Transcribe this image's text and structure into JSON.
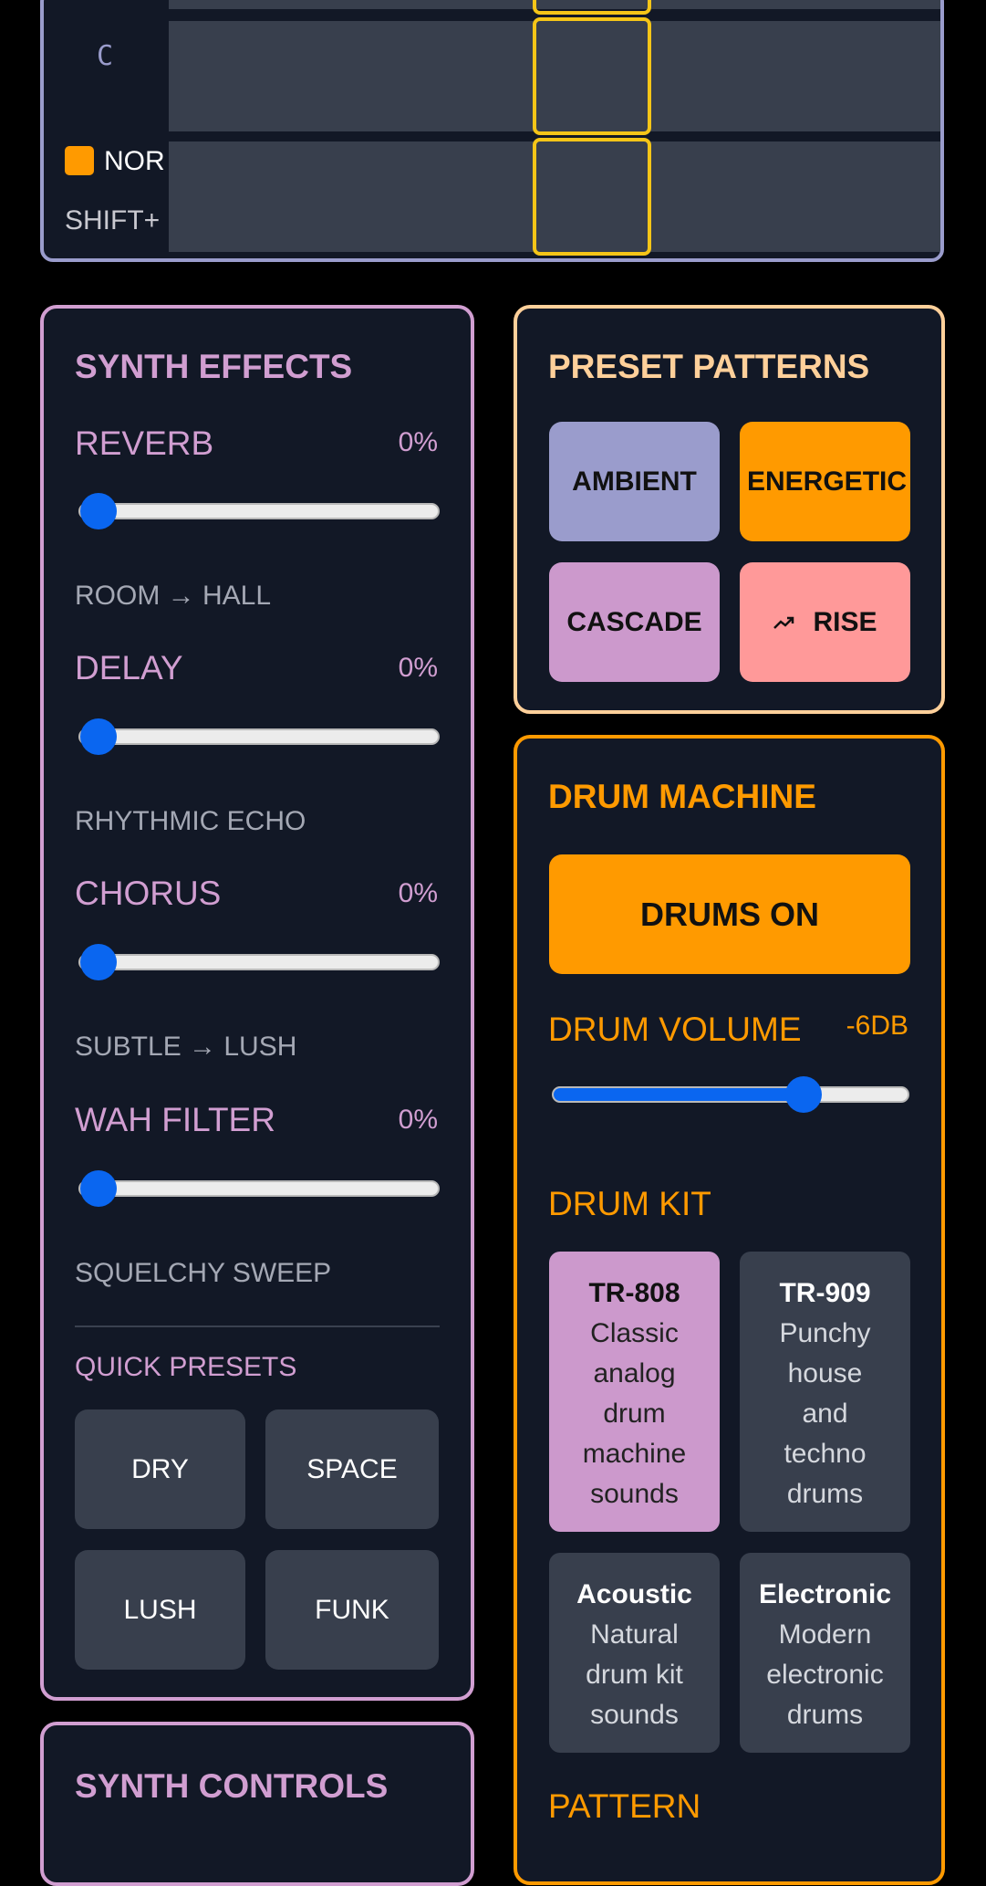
{
  "sequencer": {
    "note_label": "C",
    "mode_label": "NOR",
    "shift_label": "SHIFT+",
    "mode_color": "#ff9a00",
    "highlight_color": "#f5c518"
  },
  "synth_effects": {
    "title": "SYNTH EFFECTS",
    "effects": [
      {
        "label": "REVERB",
        "value": "0%",
        "level": 0,
        "desc": "ROOM → HALL"
      },
      {
        "label": "DELAY",
        "value": "0%",
        "level": 0,
        "desc": "RHYTHMIC ECHO"
      },
      {
        "label": "CHORUS",
        "value": "0%",
        "level": 0,
        "desc": "SUBTLE → LUSH"
      },
      {
        "label": "WAH FILTER",
        "value": "0%",
        "level": 0,
        "desc": "SQUELCHY SWEEP"
      }
    ],
    "quick_presets_title": "QUICK PRESETS",
    "quick_presets": [
      "DRY",
      "SPACE",
      "LUSH",
      "FUNK"
    ]
  },
  "preset_patterns": {
    "title": "PRESET PATTERNS",
    "buttons": [
      {
        "label": "AMBIENT",
        "color": "#9a9ccc"
      },
      {
        "label": "ENERGETIC",
        "color": "#ff9a00"
      },
      {
        "label": "CASCADE",
        "color": "#cc99cc"
      },
      {
        "label": "RISE",
        "color": "#ff9999",
        "icon": "trend-up-icon"
      }
    ]
  },
  "drum_machine": {
    "title": "DRUM MACHINE",
    "toggle_label": "DRUMS ON",
    "volume_label": "DRUM VOLUME",
    "volume_value": "-6DB",
    "volume_level": 0.73,
    "kit_title": "DRUM KIT",
    "kits": [
      {
        "name": "TR-808",
        "desc": [
          "Classic",
          "analog",
          "drum",
          "machine",
          "sounds"
        ],
        "selected": true
      },
      {
        "name": "TR-909",
        "desc": [
          "Punchy",
          "house",
          "and",
          "techno",
          "drums"
        ],
        "selected": false
      },
      {
        "name": "Acoustic",
        "desc": [
          "Natural",
          "drum kit",
          "sounds"
        ],
        "selected": false
      },
      {
        "name": "Electronic",
        "desc": [
          "Modern",
          "electronic",
          "drums"
        ],
        "selected": false
      }
    ],
    "pattern_title": "PATTERN"
  },
  "synth_controls": {
    "title": "SYNTH CONTROLS"
  },
  "colors": {
    "effects_accent": "#d19ed1",
    "patterns_accent": "#ffd09a",
    "drum_accent": "#ff9a00",
    "slider_blue": "#0a66f0"
  }
}
